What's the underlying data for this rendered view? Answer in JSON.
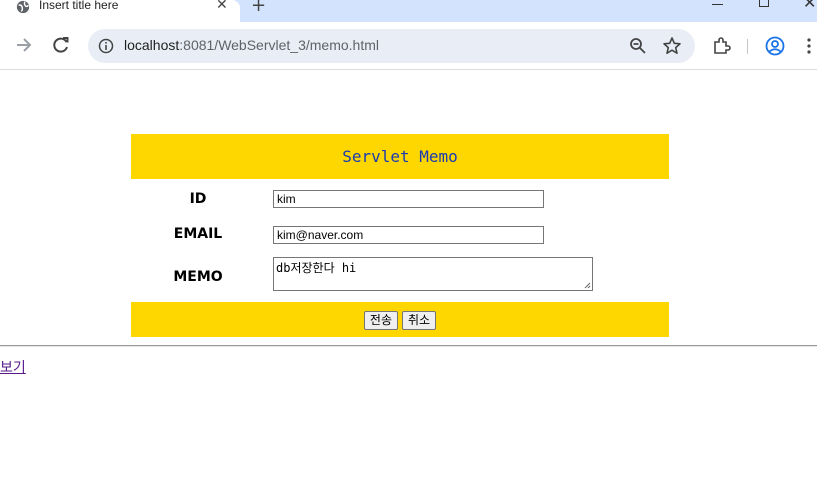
{
  "browser": {
    "tab_title": "Insert title here",
    "url_host": "localhost",
    "url_path": ":8081/WebServlet_3/memo.html"
  },
  "form": {
    "title": "Servlet Memo",
    "id_label": "ID",
    "id_value": "kim",
    "email_label": "EMAIL",
    "email_value": "kim@naver.com",
    "memo_label": "MEMO",
    "memo_value": "db저장한다 hi",
    "submit_label": "전송",
    "reset_label": "취소"
  },
  "links": {
    "view_label": "보기"
  },
  "colors": {
    "header_bg": "#ffd700",
    "title_text": "#1a3bb0",
    "link_visited": "#551a8b"
  }
}
